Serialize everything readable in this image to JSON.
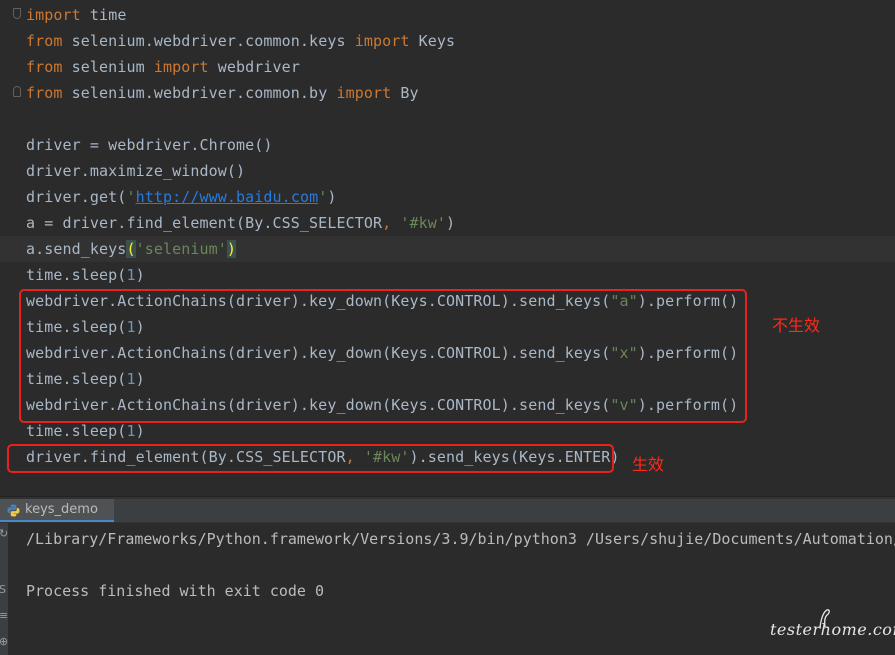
{
  "editor": {
    "lines": [
      [
        {
          "t": "import",
          "c": "kw"
        },
        {
          "t": " time",
          "c": ""
        }
      ],
      [
        {
          "t": "from",
          "c": "kw"
        },
        {
          "t": " selenium.webdriver.common.keys ",
          "c": ""
        },
        {
          "t": "import",
          "c": "kw"
        },
        {
          "t": " Keys",
          "c": ""
        }
      ],
      [
        {
          "t": "from",
          "c": "kw"
        },
        {
          "t": " selenium ",
          "c": ""
        },
        {
          "t": "import",
          "c": "kw"
        },
        {
          "t": " webdriver",
          "c": ""
        }
      ],
      [
        {
          "t": "from",
          "c": "kw"
        },
        {
          "t": " selenium.webdriver.common.by ",
          "c": ""
        },
        {
          "t": "import",
          "c": "kw"
        },
        {
          "t": " By",
          "c": ""
        }
      ],
      [],
      [
        {
          "t": "driver = webdriver.Chrome()",
          "c": ""
        }
      ],
      [
        {
          "t": "driver.maximize_window()",
          "c": ""
        }
      ],
      [
        {
          "t": "driver.get(",
          "c": ""
        },
        {
          "t": "'",
          "c": "str"
        },
        {
          "t": "http://www.baidu.com",
          "c": "url"
        },
        {
          "t": "'",
          "c": "str"
        },
        {
          "t": ")",
          "c": ""
        }
      ],
      [
        {
          "t": "a = driver.find_element(By.CSS_SELECTOR",
          "c": ""
        },
        {
          "t": ", ",
          "c": "kw"
        },
        {
          "t": "'#kw'",
          "c": "str"
        },
        {
          "t": ")",
          "c": ""
        }
      ],
      [
        {
          "t": "a.send_keys",
          "c": ""
        },
        {
          "t": "(",
          "c": "paren-hl"
        },
        {
          "t": "'selenium'",
          "c": "str"
        },
        {
          "t": ")",
          "c": "paren-hl"
        }
      ],
      [
        {
          "t": "time.sleep(",
          "c": ""
        },
        {
          "t": "1",
          "c": "num"
        },
        {
          "t": ")",
          "c": ""
        }
      ],
      [
        {
          "t": "webdriver.ActionChains(driver).key_down(Keys.CONTROL).send_keys(",
          "c": ""
        },
        {
          "t": "\"a\"",
          "c": "str"
        },
        {
          "t": ").perform()",
          "c": ""
        }
      ],
      [
        {
          "t": "time.sleep(",
          "c": ""
        },
        {
          "t": "1",
          "c": "num"
        },
        {
          "t": ")",
          "c": ""
        }
      ],
      [
        {
          "t": "webdriver.ActionChains(driver).key_down(Keys.CONTROL).send_keys(",
          "c": ""
        },
        {
          "t": "\"x\"",
          "c": "str"
        },
        {
          "t": ").perform()",
          "c": ""
        }
      ],
      [
        {
          "t": "time.sleep(",
          "c": ""
        },
        {
          "t": "1",
          "c": "num"
        },
        {
          "t": ")",
          "c": ""
        }
      ],
      [
        {
          "t": "webdriver.ActionChains(driver).key_down(Keys.CONTROL).send_keys(",
          "c": ""
        },
        {
          "t": "\"v\"",
          "c": "str"
        },
        {
          "t": ").perform()",
          "c": ""
        }
      ],
      [
        {
          "t": "time.sleep(",
          "c": ""
        },
        {
          "t": "1",
          "c": "num"
        },
        {
          "t": ")",
          "c": ""
        }
      ],
      [
        {
          "t": "driver.find_element(By.CSS_SELECTOR",
          "c": ""
        },
        {
          "t": ", ",
          "c": "kw"
        },
        {
          "t": "'#kw'",
          "c": "str"
        },
        {
          "t": ").send_keys(Keys.ENTER)",
          "c": ""
        }
      ]
    ]
  },
  "annotations": {
    "not_effective": "不生效",
    "effective": "生效"
  },
  "run_panel": {
    "tab_label": "keys_demo",
    "output_lines": [
      "/Library/Frameworks/Python.framework/Versions/3.9/bin/python3 /Users/shujie/Documents/Automation/",
      "",
      "Process finished with exit code 0"
    ]
  },
  "watermark": "testerhome.com",
  "colors": {
    "background": "#2b2b2b",
    "keyword": "#cc7832",
    "string": "#6a8759",
    "number": "#6897bb",
    "default_text": "#a9b7c6",
    "annotation_red": "#e8231f"
  }
}
